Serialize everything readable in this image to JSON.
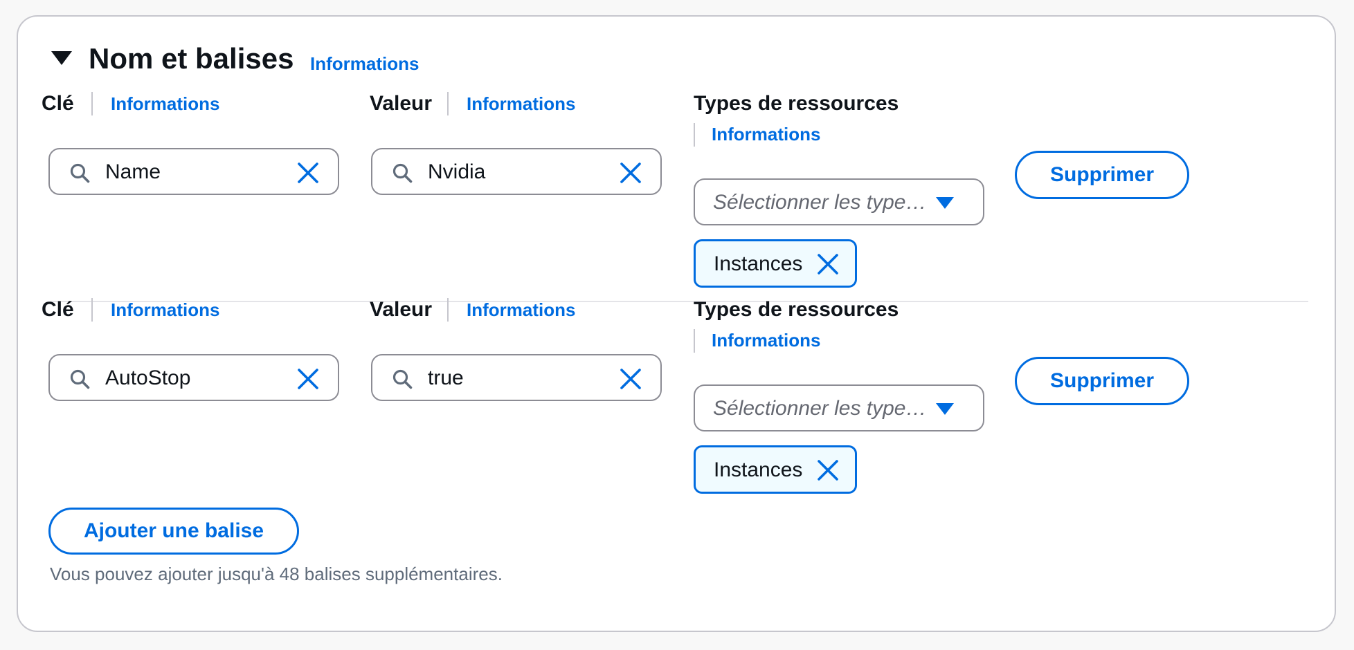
{
  "section": {
    "title": "Nom et balises",
    "info_link": "Informations"
  },
  "labels": {
    "key": "Clé",
    "value": "Valeur",
    "resource_types": "Types de ressources",
    "info": "Informations"
  },
  "tags": [
    {
      "key": "Name",
      "value": "Nvidia",
      "resource_select_placeholder": "Sélectionner les type…",
      "selected_resource": "Instances",
      "remove_label": "Supprimer"
    },
    {
      "key": "AutoStop",
      "value": "true",
      "resource_select_placeholder": "Sélectionner les type…",
      "selected_resource": "Instances",
      "remove_label": "Supprimer"
    }
  ],
  "add_tag_label": "Ajouter une balise",
  "hint": "Vous pouvez ajouter jusqu'à 48 balises supplémentaires.",
  "icons": {
    "header": "caret-down-icon",
    "input_prefix": "search-icon",
    "input_clear": "close-icon",
    "select": "dropdown-arrow-icon",
    "token_remove": "close-icon"
  },
  "colors": {
    "accent": "#006ce0",
    "border": "#8c8c94",
    "token_bg": "#f0fbff",
    "text": "#0f141a",
    "muted": "#5f6b7a"
  }
}
